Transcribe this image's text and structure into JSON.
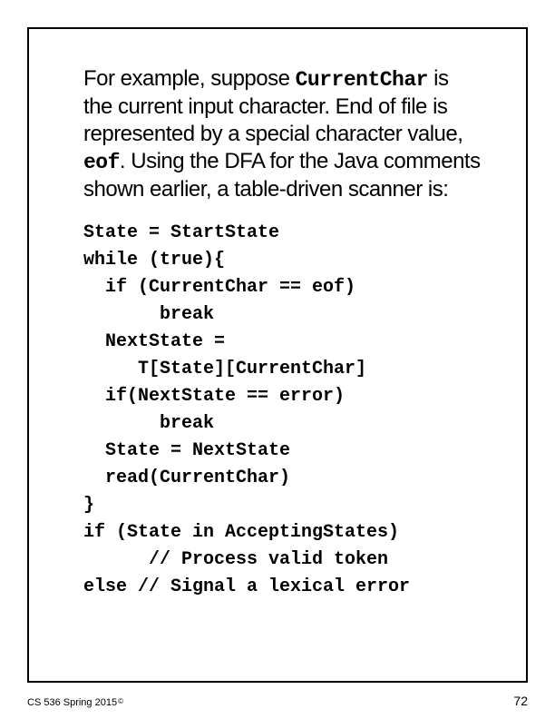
{
  "intro": {
    "part1": "For example, suppose ",
    "code1": "CurrentChar",
    "part2": " is the current input character. End of file is represented by a special character value, ",
    "code2": "eof",
    "part3": ". Using the DFA for the Java comments shown earlier, a table-driven scanner is:"
  },
  "code": {
    "l1": "State = StartState",
    "l2": "while (true){",
    "l3": "  if (CurrentChar == eof)",
    "l4": "       break",
    "l5": "  NextState =",
    "l6": "     T[State][CurrentChar]",
    "l7": "  if(NextState == error)",
    "l8": "       break",
    "l9": "  State = NextState",
    "l10": "  read(CurrentChar)",
    "l11": "}",
    "l12": "if (State in AcceptingStates)",
    "l13": "      // Process valid token",
    "l14": "else // Signal a lexical error"
  },
  "footer": {
    "course": "CS 536  Spring 2015",
    "copyright": "©",
    "page": "72"
  }
}
